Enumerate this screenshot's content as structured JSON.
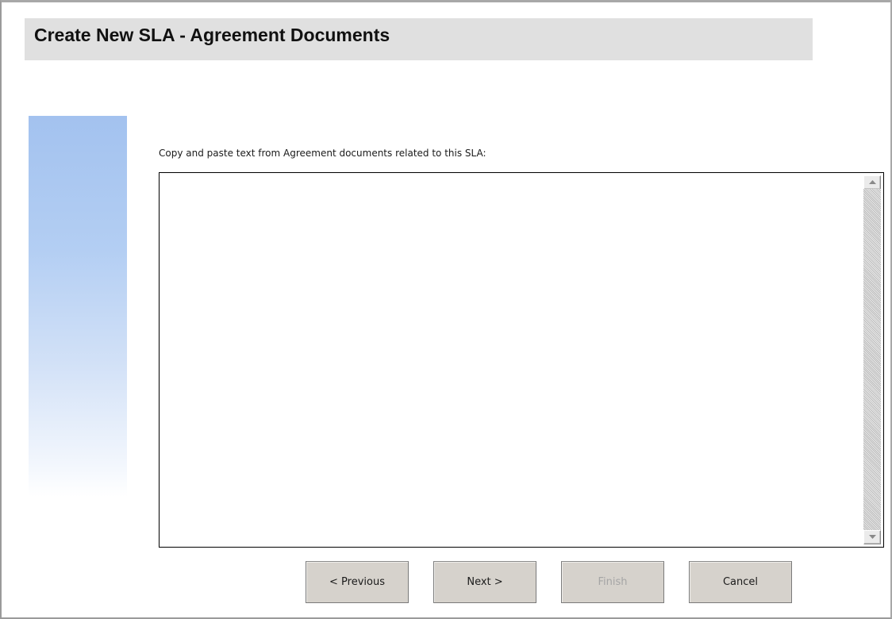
{
  "header": {
    "title": "Create New SLA - Agreement Documents"
  },
  "form": {
    "instruction": "Copy and paste text from Agreement documents related to this SLA:",
    "agreement_text": {
      "value": "",
      "placeholder": ""
    }
  },
  "buttons": {
    "previous": "< Previous",
    "next": "Next >",
    "finish": "Finish",
    "cancel": "Cancel",
    "finish_enabled": false
  },
  "colors": {
    "title_bar": "#e0e0e0",
    "side_gradient_top": "#a3c2ef",
    "button_face": "#d6d2cc",
    "disabled_text": "#a5a5a5"
  },
  "icons": {
    "scroll_up": "triangle-up-icon",
    "scroll_down": "triangle-down-icon"
  }
}
